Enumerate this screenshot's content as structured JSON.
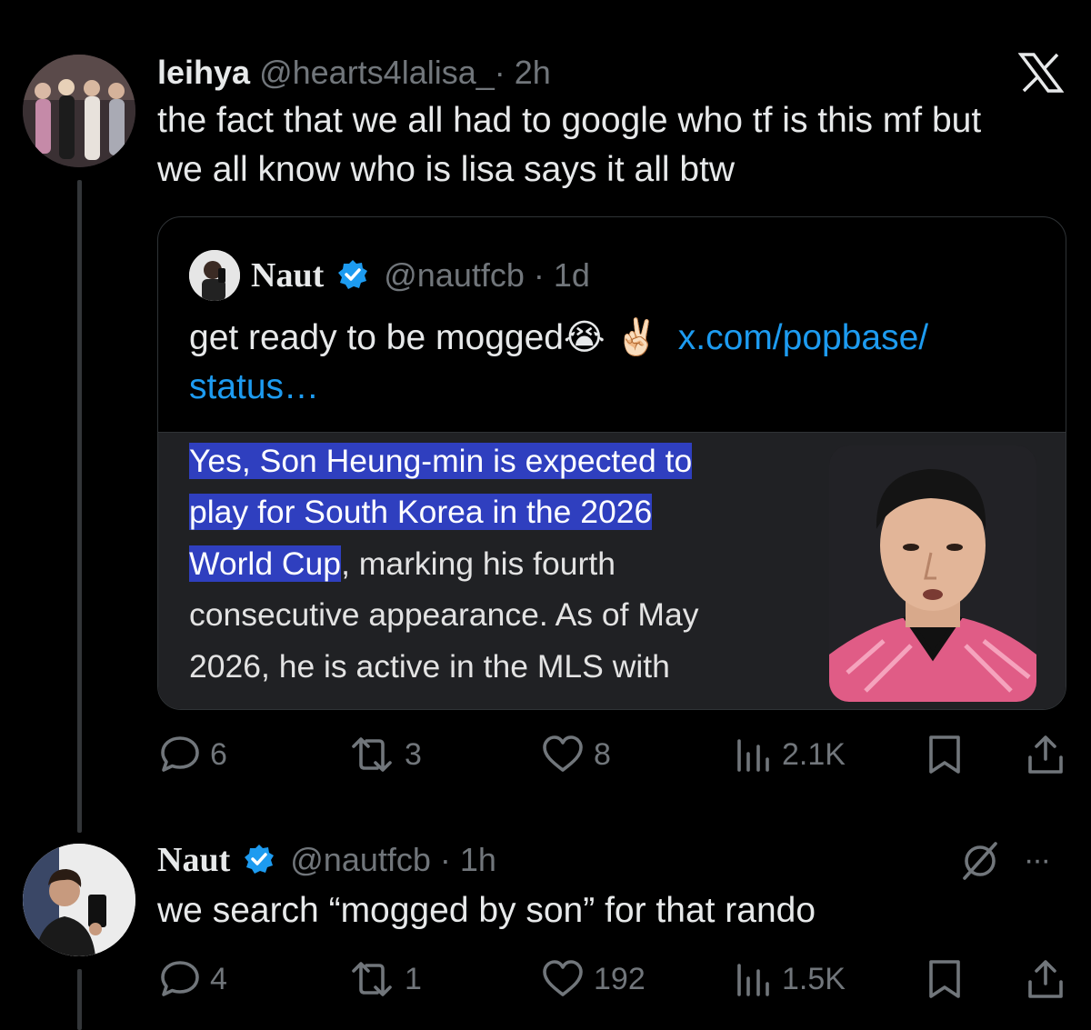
{
  "app": {
    "logo": "x-logo-icon"
  },
  "main_tweet": {
    "display_name": "leihya",
    "handle": "@hearts4lalisa_",
    "time": "· 2h",
    "text_line1": "the fact that we all had to google who tf is this mf but",
    "text_line2": "we all know who is lisa says it all btw",
    "quote": {
      "display_name": "Naut",
      "handle": "@nautfcb",
      "time": "· 1d",
      "text": "get ready to be mogged",
      "emoji1": "😭",
      "emoji2": "✌🏻",
      "link_part1": "x.com/popbase/",
      "link_part2": "status…",
      "media": {
        "line1": "Yes, Son Heung-min is expected to",
        "line2": "play for South Korea in the 2026",
        "line3_highlight": "World Cup",
        "line3_rest": ", marking his fourth",
        "line4": "consecutive appearance. As of May",
        "line5": "2026, he is active in the MLS with"
      }
    },
    "stats": {
      "replies": "6",
      "reposts": "3",
      "likes": "8",
      "views": "2.1K"
    }
  },
  "reply_tweet": {
    "display_name": "Naut",
    "handle": "@nautfcb",
    "time": "· 1h",
    "text": "we search “mogged by son” for that rando",
    "more": "···",
    "stats": {
      "replies": "4",
      "reposts": "1",
      "likes": "192",
      "views": "1.5K"
    }
  },
  "colors": {
    "background": "#000000",
    "link": "#1d9bf0",
    "verified": "#1d9bf0",
    "highlight": "#2f3fbf",
    "muted": "#71767b"
  }
}
